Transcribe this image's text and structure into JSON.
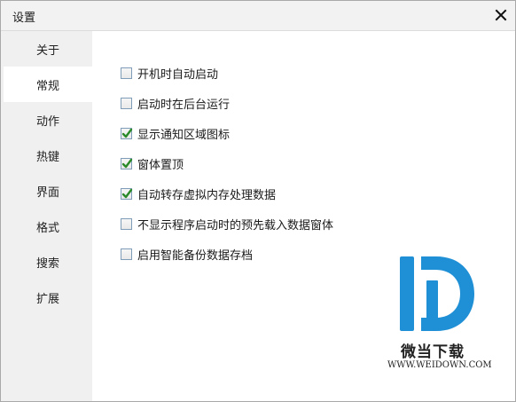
{
  "window": {
    "title": "设置"
  },
  "sidebar": {
    "items": [
      {
        "label": "关于",
        "active": false
      },
      {
        "label": "常规",
        "active": true
      },
      {
        "label": "动作",
        "active": false
      },
      {
        "label": "热键",
        "active": false
      },
      {
        "label": "界面",
        "active": false
      },
      {
        "label": "格式",
        "active": false
      },
      {
        "label": "搜索",
        "active": false
      },
      {
        "label": "扩展",
        "active": false
      }
    ]
  },
  "options": [
    {
      "label": "开机时自动启动",
      "checked": false
    },
    {
      "label": "启动时在后台运行",
      "checked": false
    },
    {
      "label": "显示通知区域图标",
      "checked": true
    },
    {
      "label": "窗体置顶",
      "checked": true
    },
    {
      "label": "自动转存虚拟内存处理数据",
      "checked": true
    },
    {
      "label": "不显示程序启动时的预先载入数据窗体",
      "checked": false
    },
    {
      "label": "启用智能备份数据存档",
      "checked": false
    }
  ],
  "watermark": {
    "brand": "微当下载",
    "url": "WWW.WEIDOWN.COM"
  },
  "colors": {
    "accent_logo": "#1f8fd6",
    "check_green": "#2a8a2a"
  }
}
